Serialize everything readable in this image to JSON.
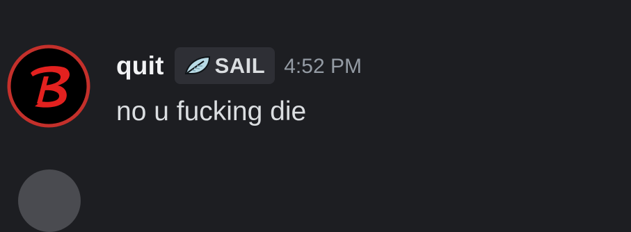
{
  "message": {
    "username": "quit",
    "role_tag": {
      "label": "SAIL",
      "icon": "leaf-icon",
      "icon_color": "#b9dbe6"
    },
    "timestamp": "4:52 PM",
    "content": "no u fucking die",
    "avatar": {
      "icon": "letter-b-logo",
      "letter": "B",
      "ring_color": "#c4302b",
      "fill_color": "#000000"
    }
  },
  "colors": {
    "background": "#1d1e22",
    "username": "#f2f3f5",
    "text": "#dbdee1",
    "muted": "#949ba4",
    "tag_background": "#2e2f35"
  }
}
